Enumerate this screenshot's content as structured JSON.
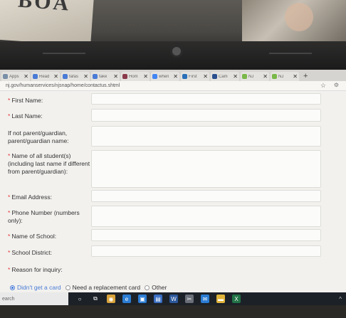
{
  "backdrop": {
    "paper_text": "BOA"
  },
  "browser": {
    "tabs": [
      {
        "title": "Apps",
        "color": "#7a8fa8"
      },
      {
        "title": "Read",
        "color": "#4a7bd6"
      },
      {
        "title": "fafas",
        "color": "#4a7bd6"
      },
      {
        "title": "fake",
        "color": "#4a7bd6"
      },
      {
        "title": "Hom",
        "color": "#8a3a4a"
      },
      {
        "title": "when",
        "color": "#4285f4"
      },
      {
        "title": "First",
        "color": "#2a6fb8"
      },
      {
        "title": "Cam",
        "color": "#2a4f8f"
      },
      {
        "title": "NJ",
        "color": "#7ab848"
      },
      {
        "title": "NJ",
        "color": "#7ab848"
      }
    ],
    "new_tab_icon": "+",
    "close_icon": "✕",
    "url": "nj.gov/humanservices/njsnap/home/contactus.shtml"
  },
  "form": {
    "required_mark": "*",
    "fields": [
      {
        "label": "First Name:",
        "required": true
      },
      {
        "label": "Last Name:",
        "required": true
      },
      {
        "label": "If not parent/guardian, parent/guardian name:",
        "required": false
      },
      {
        "label": "Name of all student(s) (including last name if different from parent/guardian):",
        "required": true
      },
      {
        "label": "Email Address:",
        "required": true
      },
      {
        "label": "Phone Number (numbers only):",
        "required": true
      },
      {
        "label": "Name of School:",
        "required": true
      },
      {
        "label": "School District:",
        "required": true
      }
    ],
    "reason_label": "Reason for inquiry:",
    "reasons": [
      {
        "label": "Didn't get a card",
        "selected": true
      },
      {
        "label": "Need a replacement card",
        "selected": false
      },
      {
        "label": "Other",
        "selected": false
      }
    ]
  },
  "taskbar": {
    "search_text": "earch",
    "icons": [
      "windows-icon",
      "task-view-icon",
      "chrome-icon",
      "edge-icon",
      "store-icon",
      "photos-icon",
      "word-icon",
      "snip-icon",
      "mail-icon",
      "folder-icon",
      "excel-icon"
    ]
  }
}
